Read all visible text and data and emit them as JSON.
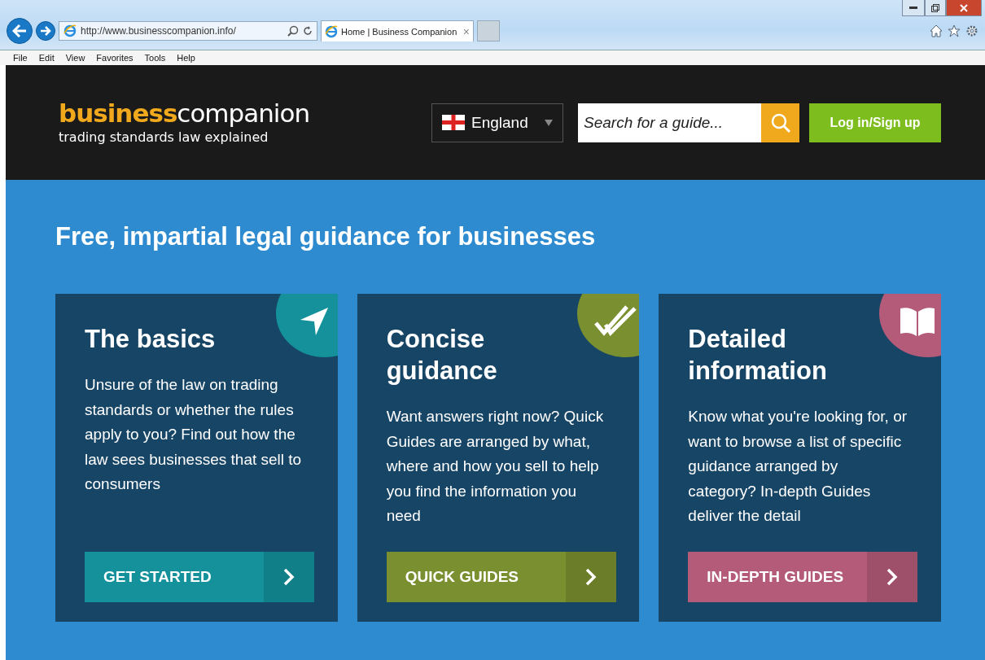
{
  "browser": {
    "address": "http://www.businesscompanion.info/",
    "tab": {
      "title": "Home | Business Companion",
      "close": "×"
    },
    "menu": [
      "File",
      "Edit",
      "View",
      "Favorites",
      "Tools",
      "Help"
    ]
  },
  "header": {
    "logo_bold": "business",
    "logo_light": "companion",
    "tagline": "trading standards law explained",
    "region": "England",
    "search": {
      "placeholder": "Search for a guide..."
    },
    "login": "Log in/Sign up"
  },
  "hero": {
    "title": "Free, impartial legal guidance for businesses"
  },
  "cards": [
    {
      "kind": "arrow",
      "color": "#14919b",
      "title": "The basics",
      "text": "Unsure of the law on trading standards or whether the rules apply to you? Find out how the law sees businesses that sell to consumers",
      "button": "GET STARTED"
    },
    {
      "kind": "check",
      "color": "#7a8f2f",
      "title": "Concise guidance",
      "text": "Want answers right now? Quick Guides are arranged by what, where and how you sell to help you find the information you need",
      "button": "QUICK GUIDES"
    },
    {
      "kind": "book",
      "color": "#b45b79",
      "title": "Detailed information",
      "text": "Know what you're looking for, or want to browse a list of specific guidance arranged by category? In-depth Guides deliver the detail",
      "button": "IN-DEPTH GUIDES"
    }
  ]
}
